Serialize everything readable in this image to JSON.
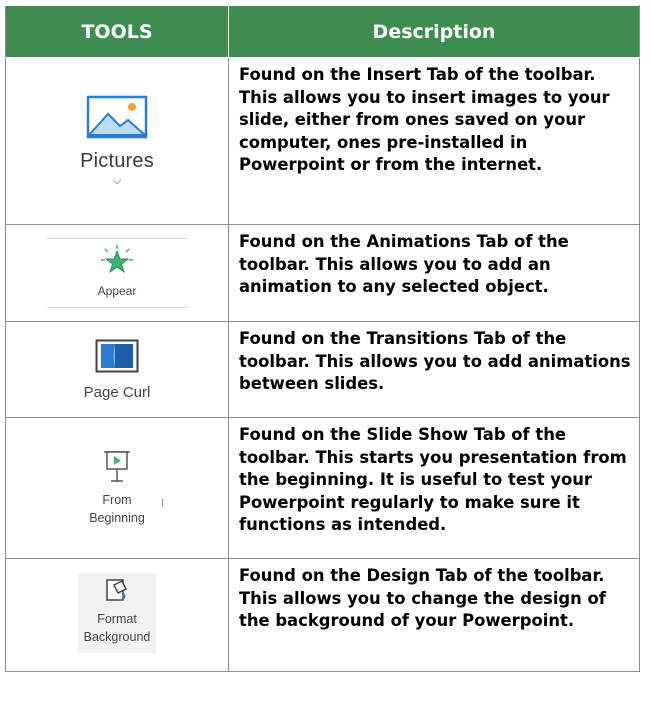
{
  "header": {
    "tools": "TOOLS",
    "description": "Description"
  },
  "rows": [
    {
      "tool_label": "Pictures",
      "icon": "picture-icon",
      "description": "Found on the Insert Tab of the toolbar. This allows you to insert images to your slide, either from ones saved on your computer, ones pre-installed in Powerpoint or from the internet."
    },
    {
      "tool_label": "Appear",
      "icon": "star-burst-icon",
      "description": "Found on the Animations Tab of the toolbar. This allows you to add an animation to any selected object."
    },
    {
      "tool_label": "Page Curl",
      "icon": "page-curl-icon",
      "description": "Found on the Transitions Tab of the toolbar. This allows you to add animations between slides."
    },
    {
      "tool_label_line1": "From",
      "tool_label_line2": "Beginning",
      "icon": "projector-screen-play-icon",
      "description": "Found on the Slide Show Tab of the toolbar. This starts you presentation from the beginning. It is useful to test your Powerpoint regularly to make sure it functions as intended."
    },
    {
      "tool_label_line1": "Format",
      "tool_label_line2": "Background",
      "icon": "format-background-icon",
      "description": "Found on the Design Tab of the toolbar. This allows you to change the design of the background of your Powerpoint."
    }
  ],
  "colors": {
    "header_bg": "#3c8d4f",
    "header_text": "#ffffff",
    "icon_blue": "#2b7cd3",
    "star_green": "#3cb371"
  }
}
